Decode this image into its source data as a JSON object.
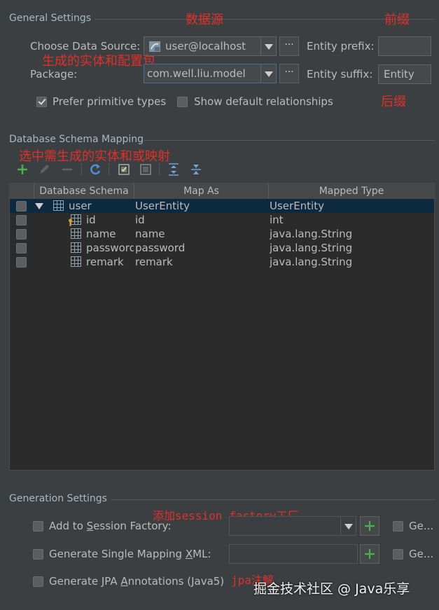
{
  "general": {
    "title": "General Settings",
    "data_source_label": "Choose Data Source:",
    "data_source_value": "user@localhost",
    "package_label": "Package:",
    "package_value": "com.well.liu.model",
    "browse": "···",
    "entity_prefix_label": "Entity prefix:",
    "entity_prefix_value": "",
    "entity_suffix_label": "Entity suffix:",
    "entity_suffix_value": "Entity",
    "prefer_primitive": {
      "label": "Prefer primitive types",
      "checked": true
    },
    "show_relationships": {
      "label": "Show default relationships",
      "checked": false
    }
  },
  "annotations": {
    "data_source": "数据源",
    "prefix": "前缀",
    "entity_package": "生成的实体和配置包",
    "suffix": "后缀",
    "select_mapping": "选中需生成的实体和或映射",
    "session_factory": "添加session factory工厂",
    "jpa": "jpa注解",
    "watermark": "掘金技术社区 @ Java乐享"
  },
  "schema": {
    "title": "Database Schema Mapping",
    "toolbar": [
      "add-icon",
      "edit-icon",
      "remove-icon",
      "refresh-icon",
      "check-all-icon",
      "uncheck-all-icon",
      "expand-all-icon",
      "collapse-all-icon"
    ],
    "columns": [
      "Database Schema",
      "Map As",
      "Mapped Type"
    ],
    "rows": [
      {
        "name": "user",
        "map_as": "UserEntity",
        "type": "UserEntity",
        "kind": "table",
        "selected": true
      },
      {
        "name": "id",
        "map_as": "id",
        "type": "int",
        "kind": "key-column"
      },
      {
        "name": "name",
        "map_as": "name",
        "type": "java.lang.String",
        "kind": "column"
      },
      {
        "name": "password",
        "map_as": "password",
        "type": "java.lang.String",
        "kind": "column"
      },
      {
        "name": "remark",
        "map_as": "remark",
        "type": "java.lang.String",
        "kind": "column"
      }
    ]
  },
  "generation": {
    "title": "Generation Settings",
    "add_session_factory": "Add to Session Factory:",
    "single_mapping_xml": "Generate Single Mapping XML:",
    "jpa_annotations": "Generate JPA Annotations (Java5)",
    "ge_truncated": "Ge..."
  },
  "colors": {
    "background": "#3c3f41",
    "annotation_red": "#e0302a",
    "selection": "#0d293e",
    "add_green": "#4caf50"
  }
}
